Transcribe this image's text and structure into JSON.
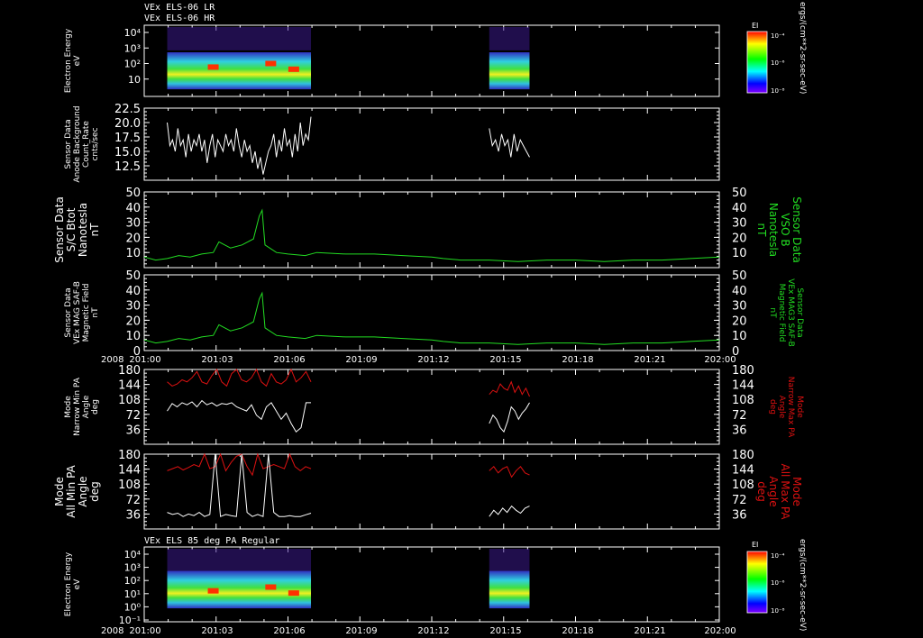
{
  "header": {
    "line1": "VEx ELS-06 LR",
    "line2": "VEx ELS-06 HR"
  },
  "colorbar_units": "ergs/(cm**2-sr-sec-eV)",
  "colorbar_label": "EI",
  "colorbar_ticks": [
    "10⁻⁴",
    "10⁻⁶",
    "10⁻⁸"
  ],
  "colors": {
    "white_trace": "#ffffff",
    "green_trace": "#22dd22",
    "red_trace": "#dd1111",
    "frame": "#ffffff"
  },
  "time_axis": {
    "year_label": "2008",
    "ticks": [
      "201:00",
      "201:03",
      "201:06",
      "201:09",
      "201:12",
      "201:15",
      "201:18",
      "201:21",
      "202:00"
    ]
  },
  "chart_data": [
    {
      "type": "heatmap",
      "name": "panel-spectrogram-top",
      "ylabel": [
        "Electron Energy",
        "eV"
      ],
      "yticks": [
        "10⁴",
        "10³",
        "10²",
        "10"
      ],
      "log_scale": true,
      "intervals_doy": [
        [
          201.04,
          201.29
        ],
        [
          201.6,
          201.67
        ]
      ]
    },
    {
      "type": "line",
      "name": "panel-anode-background",
      "ylabel": [
        "Sensor Data",
        "Anode Background",
        "Count_Rate",
        "cnts/sec"
      ],
      "ylim": [
        10,
        22.5
      ],
      "yticks": [
        "22.5",
        "20.0",
        "17.5",
        "15.0",
        "12.5"
      ],
      "series": [
        {
          "color": "white",
          "segments": [
            {
              "t0": 201.04,
              "t1": 201.29,
              "values": [
                20,
                16,
                17,
                15,
                19,
                16,
                17,
                14,
                18,
                15,
                17,
                16,
                18,
                15,
                17,
                13,
                16,
                18,
                14,
                17,
                16,
                15,
                18,
                16,
                17,
                15,
                19,
                16,
                14,
                17,
                15,
                16,
                13,
                15,
                12,
                14,
                11,
                13,
                15,
                16,
                18,
                14,
                17,
                15,
                19,
                16,
                17,
                14,
                18,
                15,
                20,
                16,
                18,
                17,
                21
              ]
            },
            {
              "t0": 201.6,
              "t1": 201.67,
              "values": [
                19,
                16,
                17,
                15,
                18,
                16,
                17,
                14,
                18,
                15,
                17,
                16,
                15,
                14
              ]
            }
          ]
        }
      ]
    },
    {
      "type": "line",
      "name": "panel-bmag-vso",
      "ylabel": [
        "Sensor Data",
        "S/C Btot",
        "Nanotesla",
        "nT"
      ],
      "ylabel_right": [
        "Sensor Data",
        "VSO B",
        "Nanotesla",
        "nT"
      ],
      "ylim": [
        0,
        50
      ],
      "yticks": [
        50,
        40,
        30,
        20,
        10
      ],
      "series": [
        {
          "color": "green",
          "points": [
            [
              201.0,
              7
            ],
            [
              201.02,
              5
            ],
            [
              201.04,
              6
            ],
            [
              201.06,
              8
            ],
            [
              201.08,
              7
            ],
            [
              201.1,
              9
            ],
            [
              201.12,
              10
            ],
            [
              201.13,
              17
            ],
            [
              201.15,
              13
            ],
            [
              201.17,
              15
            ],
            [
              201.19,
              19
            ],
            [
              201.2,
              34
            ],
            [
              201.205,
              38
            ],
            [
              201.21,
              15
            ],
            [
              201.23,
              10
            ],
            [
              201.25,
              9
            ],
            [
              201.28,
              8
            ],
            [
              201.3,
              10
            ],
            [
              201.35,
              9
            ],
            [
              201.4,
              9
            ],
            [
              201.45,
              8
            ],
            [
              201.5,
              7
            ],
            [
              201.52,
              6
            ],
            [
              201.55,
              5
            ],
            [
              201.6,
              5
            ],
            [
              201.65,
              4
            ],
            [
              201.7,
              5
            ],
            [
              201.75,
              5
            ],
            [
              201.8,
              4
            ],
            [
              201.85,
              5
            ],
            [
              201.9,
              5
            ],
            [
              201.95,
              6
            ],
            [
              202.0,
              7
            ]
          ]
        }
      ]
    },
    {
      "type": "line",
      "name": "panel-bmag-saf",
      "ylabel": [
        "Sensor Data",
        "VEx MAG SAF-B",
        "Magnetic Field",
        "nT"
      ],
      "ylabel_right": [
        "Sensor Data",
        "VEx MAG3 SAF-B",
        "Magnetic Field",
        "nT"
      ],
      "ylim": [
        0,
        50
      ],
      "yticks": [
        50,
        40,
        30,
        20,
        10,
        0
      ],
      "series": [
        {
          "color": "green",
          "points": [
            [
              201.0,
              7
            ],
            [
              201.02,
              5
            ],
            [
              201.04,
              6
            ],
            [
              201.06,
              8
            ],
            [
              201.08,
              7
            ],
            [
              201.1,
              9
            ],
            [
              201.12,
              10
            ],
            [
              201.13,
              17
            ],
            [
              201.15,
              13
            ],
            [
              201.17,
              15
            ],
            [
              201.19,
              19
            ],
            [
              201.2,
              34
            ],
            [
              201.205,
              38
            ],
            [
              201.21,
              15
            ],
            [
              201.23,
              10
            ],
            [
              201.25,
              9
            ],
            [
              201.28,
              8
            ],
            [
              201.3,
              10
            ],
            [
              201.35,
              9
            ],
            [
              201.4,
              9
            ],
            [
              201.45,
              8
            ],
            [
              201.5,
              7
            ],
            [
              201.52,
              6
            ],
            [
              201.55,
              5
            ],
            [
              201.6,
              5
            ],
            [
              201.65,
              4
            ],
            [
              201.7,
              5
            ],
            [
              201.75,
              5
            ],
            [
              201.8,
              4
            ],
            [
              201.85,
              5
            ],
            [
              201.9,
              5
            ],
            [
              201.95,
              6
            ],
            [
              202.0,
              7
            ]
          ]
        }
      ]
    },
    {
      "type": "line",
      "name": "panel-narrow-pa",
      "ylabel": [
        "Mode",
        "Narrow Min PA",
        "Angle",
        "deg"
      ],
      "ylabel_right": [
        "Mode",
        "Narrow Max PA",
        "Angle",
        "deg"
      ],
      "ylim": [
        0,
        180
      ],
      "yticks": [
        180,
        144,
        108,
        72,
        36
      ],
      "series": [
        {
          "color": "red",
          "segments": [
            {
              "t0": 201.04,
              "t1": 201.29,
              "values": [
                150,
                140,
                145,
                155,
                150,
                160,
                175,
                150,
                145,
                165,
                180,
                150,
                140,
                170,
                180,
                155,
                150,
                160,
                180,
                150,
                140,
                170,
                150,
                145,
                155,
                180,
                150,
                160,
                175,
                150
              ]
            },
            {
              "t0": 201.6,
              "t1": 201.67,
              "values": [
                120,
                130,
                125,
                145,
                135,
                130,
                150,
                125,
                140,
                120,
                135,
                115
              ]
            }
          ]
        },
        {
          "color": "white",
          "segments": [
            {
              "t0": 201.04,
              "t1": 201.29,
              "values": [
                80,
                98,
                90,
                100,
                95,
                102,
                90,
                105,
                95,
                100,
                92,
                98,
                96,
                100,
                90,
                85,
                80,
                95,
                70,
                60,
                90,
                100,
                80,
                60,
                75,
                50,
                30,
                40,
                100,
                100
              ]
            },
            {
              "t0": 201.6,
              "t1": 201.67,
              "values": [
                50,
                70,
                60,
                40,
                30,
                55,
                90,
                80,
                60,
                75,
                85,
                100
              ]
            }
          ]
        }
      ]
    },
    {
      "type": "line",
      "name": "panel-all-pa",
      "ylabel": [
        "Mode",
        "All Min PA",
        "Angle",
        "deg"
      ],
      "ylabel_right": [
        "Mode",
        "All Max PA",
        "Angle",
        "deg"
      ],
      "ylim": [
        0,
        180
      ],
      "yticks": [
        180,
        144,
        108,
        72,
        36
      ],
      "series": [
        {
          "color": "red",
          "segments": [
            {
              "t0": 201.04,
              "t1": 201.29,
              "values": [
                140,
                145,
                150,
                142,
                148,
                155,
                150,
                180,
                145,
                150,
                180,
                140,
                160,
                175,
                180,
                150,
                130,
                180,
                145,
                150,
                155,
                150,
                145,
                180,
                150,
                140,
                150,
                145
              ]
            },
            {
              "t0": 201.6,
              "t1": 201.67,
              "values": [
                140,
                150,
                135,
                145,
                150,
                125,
                140,
                150,
                135,
                130
              ]
            }
          ]
        },
        {
          "color": "white",
          "segments": [
            {
              "t0": 201.04,
              "t1": 201.29,
              "values": [
                40,
                35,
                38,
                30,
                36,
                32,
                40,
                30,
                35,
                180,
                30,
                35,
                32,
                30,
                180,
                40,
                30,
                35,
                30,
                180,
                40,
                30,
                30,
                32,
                30,
                30,
                34,
                38
              ]
            },
            {
              "t0": 201.6,
              "t1": 201.67,
              "values": [
                30,
                45,
                35,
                50,
                40,
                55,
                45,
                38,
                50,
                55
              ]
            }
          ]
        }
      ]
    },
    {
      "type": "heatmap",
      "name": "panel-spectrogram-bottom",
      "title": "VEx ELS 85 deg PA Regular",
      "ylabel": [
        "Electron Energy",
        "eV"
      ],
      "yticks": [
        "10⁴",
        "10³",
        "10²",
        "10¹",
        "10⁰",
        "10⁻¹"
      ],
      "log_scale": true,
      "intervals_doy": [
        [
          201.04,
          201.29
        ],
        [
          201.6,
          201.67
        ]
      ]
    }
  ]
}
